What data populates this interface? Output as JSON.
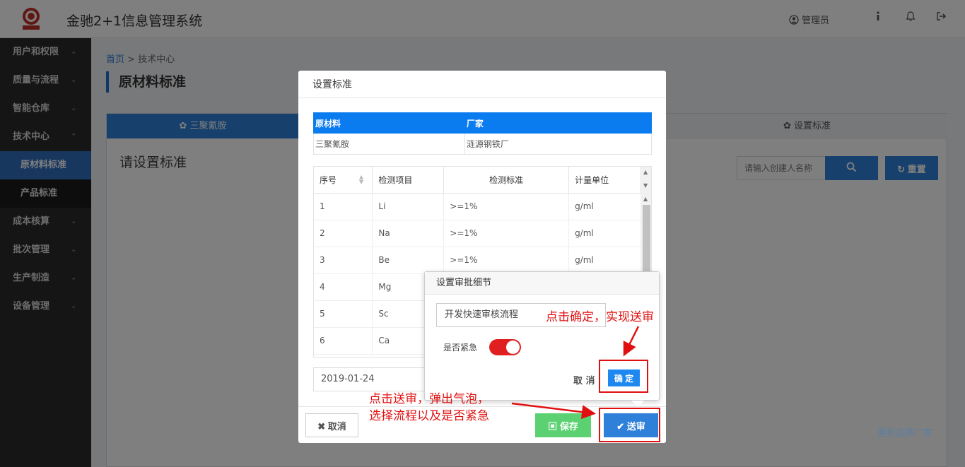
{
  "header": {
    "app_title": "金驰2+1信息管理系统",
    "user_label": "管理员",
    "icons": [
      "user-icon",
      "info-icon",
      "bell-icon",
      "logout-icon"
    ]
  },
  "sidebar": {
    "items": [
      {
        "label": "用户和权限"
      },
      {
        "label": "质量与流程"
      },
      {
        "label": "智能仓库"
      },
      {
        "label": "技术中心",
        "expanded": true,
        "children": [
          {
            "label": "原材料标准",
            "active": true
          },
          {
            "label": "产品标准"
          }
        ]
      },
      {
        "label": "成本核算"
      },
      {
        "label": "批次管理"
      },
      {
        "label": "生产制造"
      },
      {
        "label": "设备管理"
      }
    ]
  },
  "breadcrumb": {
    "home": "首页",
    "separator": ">",
    "current": "技术中心"
  },
  "page": {
    "title": "原材料标准",
    "heading": "请设置标准",
    "tab_left": "三聚氰胺",
    "tab_right": "设置标准",
    "search_placeholder": "请输入创建人名称",
    "reset_label": "重置",
    "reselect_link": "重新选择厂家"
  },
  "modal": {
    "title": "设置标准",
    "info_headers": [
      "原材料",
      "厂家"
    ],
    "info_values": [
      "三聚氰胺",
      "涟源钢铁厂"
    ],
    "grid_headers": [
      "序号",
      "检测项目",
      "检测标准",
      "计量单位"
    ],
    "grid_rows": [
      [
        "1",
        "Li",
        ">=1%",
        "g/ml"
      ],
      [
        "2",
        "Na",
        ">=1%",
        "g/ml"
      ],
      [
        "3",
        "Be",
        ">=1%",
        "g/ml"
      ],
      [
        "4",
        "Mg",
        "",
        ""
      ],
      [
        "5",
        "Sc",
        "",
        ""
      ],
      [
        "6",
        "Ca",
        "",
        ""
      ]
    ],
    "date_value": "2019-01-24",
    "cancel_label": "取消",
    "save_label": "保存",
    "submit_label": "送审"
  },
  "popover": {
    "title": "设置审批细节",
    "flow_value": "开发快速审核流程",
    "urgent_label": "是否紧急",
    "urgent": true,
    "cancel_label": "取 消",
    "ok_label": "确 定"
  },
  "annotations": {
    "top_note": "点击确定，实现送审",
    "bottom_note_line1": "点击送审，弹出气泡，",
    "bottom_note_line2": "选择流程以及是否紧急",
    "color": "#e01010"
  },
  "colors": {
    "primary": "#2f80d8",
    "success": "#5cd171",
    "danger": "#e01010",
    "sidebar": "#2b2b2b"
  }
}
